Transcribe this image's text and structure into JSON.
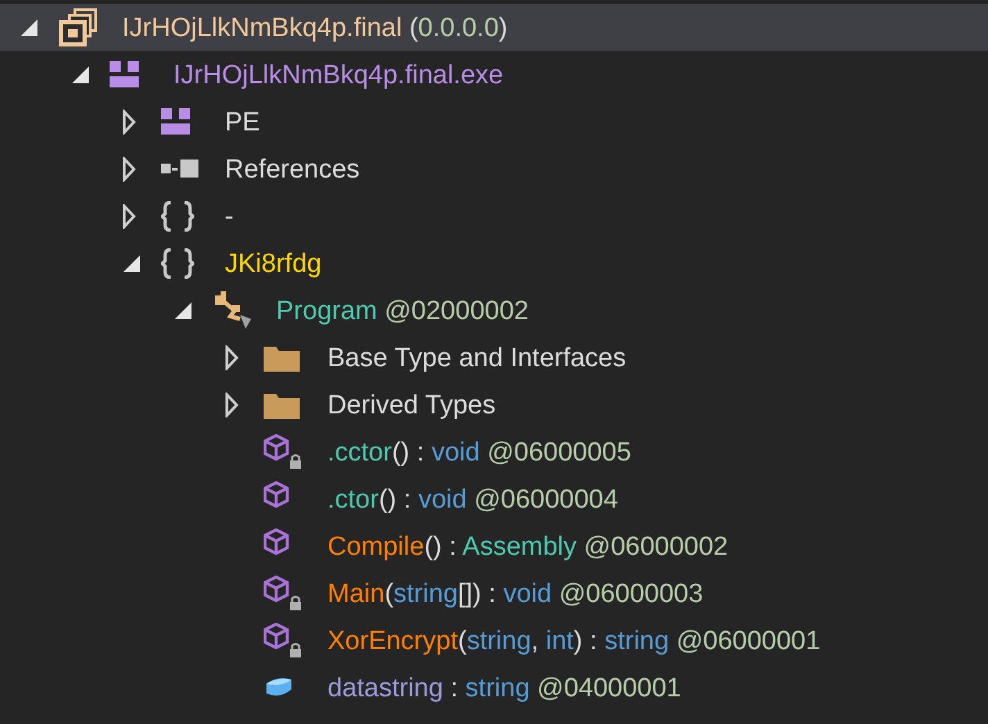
{
  "tree": [
    {
      "kind": "assembly",
      "expanded": true,
      "selected": true,
      "label": [
        {
          "text": "IJrHOjLlkNmBkq4p.final",
          "kind": "assembly"
        },
        {
          "text": " (",
          "kind": "punct"
        },
        {
          "text": "0.0.0.0",
          "kind": "number"
        },
        {
          "text": ")",
          "kind": "punct"
        }
      ],
      "children": [
        {
          "kind": "module",
          "expanded": true,
          "selected": false,
          "label": [
            {
              "text": "IJrHOjLlkNmBkq4p.final.exe",
              "kind": "module"
            }
          ],
          "children": [
            {
              "kind": "module",
              "expanded": false,
              "selected": false,
              "label": [
                {
                  "text": "PE",
                  "kind": "plain"
                }
              ]
            },
            {
              "kind": "references",
              "expanded": false,
              "selected": false,
              "label": [
                {
                  "text": "References",
                  "kind": "plain"
                }
              ]
            },
            {
              "kind": "namespace",
              "expanded": false,
              "selected": false,
              "label": [
                {
                  "text": "-",
                  "kind": "plain"
                }
              ]
            },
            {
              "kind": "namespace",
              "expanded": true,
              "selected": false,
              "label": [
                {
                  "text": "JKi8rfdg",
                  "kind": "namespace"
                }
              ],
              "children": [
                {
                  "kind": "class",
                  "expanded": true,
                  "selected": false,
                  "label": [
                    {
                      "text": "Program",
                      "kind": "type"
                    },
                    {
                      "text": " @02000002",
                      "kind": "token"
                    }
                  ],
                  "children": [
                    {
                      "kind": "folder",
                      "expanded": false,
                      "selected": false,
                      "label": [
                        {
                          "text": "Base Type and Interfaces",
                          "kind": "plain"
                        }
                      ]
                    },
                    {
                      "kind": "folder",
                      "expanded": false,
                      "selected": false,
                      "label": [
                        {
                          "text": "Derived Types",
                          "kind": "plain"
                        }
                      ]
                    },
                    {
                      "kind": "method",
                      "locked": true,
                      "selected": false,
                      "label": [
                        {
                          "text": ".cctor",
                          "kind": "type"
                        },
                        {
                          "text": "() : ",
                          "kind": "punct"
                        },
                        {
                          "text": "void",
                          "kind": "keyword"
                        },
                        {
                          "text": " @06000005",
                          "kind": "token"
                        }
                      ]
                    },
                    {
                      "kind": "method",
                      "locked": false,
                      "selected": false,
                      "label": [
                        {
                          "text": ".ctor",
                          "kind": "type"
                        },
                        {
                          "text": "() : ",
                          "kind": "punct"
                        },
                        {
                          "text": "void",
                          "kind": "keyword"
                        },
                        {
                          "text": " @06000004",
                          "kind": "token"
                        }
                      ]
                    },
                    {
                      "kind": "method",
                      "locked": false,
                      "selected": false,
                      "label": [
                        {
                          "text": "Compile",
                          "kind": "method"
                        },
                        {
                          "text": "() : ",
                          "kind": "punct"
                        },
                        {
                          "text": "Assembly",
                          "kind": "type"
                        },
                        {
                          "text": " @06000002",
                          "kind": "token"
                        }
                      ]
                    },
                    {
                      "kind": "method",
                      "locked": true,
                      "selected": false,
                      "label": [
                        {
                          "text": "Main",
                          "kind": "method"
                        },
                        {
                          "text": "(",
                          "kind": "punct"
                        },
                        {
                          "text": "string",
                          "kind": "keyword"
                        },
                        {
                          "text": "[]) : ",
                          "kind": "punct"
                        },
                        {
                          "text": "void",
                          "kind": "keyword"
                        },
                        {
                          "text": " @06000003",
                          "kind": "token"
                        }
                      ]
                    },
                    {
                      "kind": "method",
                      "locked": true,
                      "selected": false,
                      "label": [
                        {
                          "text": "XorEncrypt",
                          "kind": "method"
                        },
                        {
                          "text": "(",
                          "kind": "punct"
                        },
                        {
                          "text": "string",
                          "kind": "keyword"
                        },
                        {
                          "text": ", ",
                          "kind": "punct"
                        },
                        {
                          "text": "int",
                          "kind": "keyword"
                        },
                        {
                          "text": ") : ",
                          "kind": "punct"
                        },
                        {
                          "text": "string",
                          "kind": "keyword"
                        },
                        {
                          "text": " @06000001",
                          "kind": "token"
                        }
                      ]
                    },
                    {
                      "kind": "field",
                      "selected": false,
                      "label": [
                        {
                          "text": "datastring",
                          "kind": "field"
                        },
                        {
                          "text": " : ",
                          "kind": "punct"
                        },
                        {
                          "text": "string",
                          "kind": "keyword"
                        },
                        {
                          "text": " @04000001",
                          "kind": "token"
                        }
                      ]
                    }
                  ]
                }
              ]
            }
          ]
        }
      ]
    }
  ]
}
